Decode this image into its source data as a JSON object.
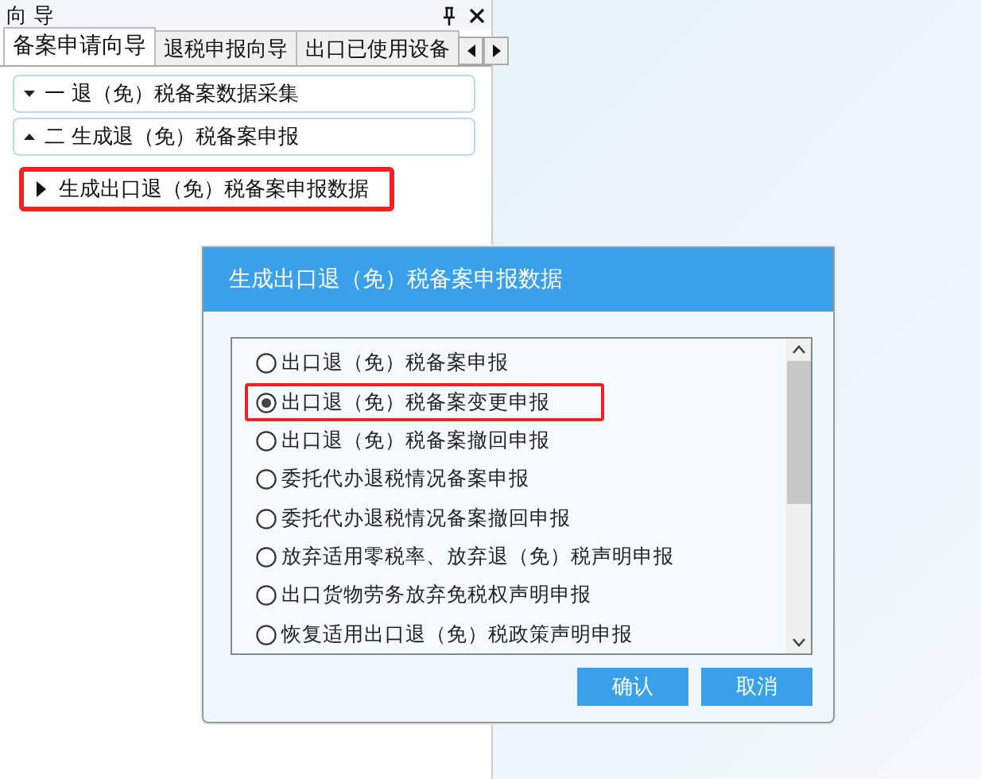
{
  "panel": {
    "title": "向 导",
    "tabs": [
      {
        "label": "备案申请向导",
        "selected": true
      },
      {
        "label": "退税申报向导",
        "selected": false
      },
      {
        "label": "出口已使用设备",
        "selected": false
      }
    ],
    "tree": [
      {
        "label": "一  退（免）税备案数据采集",
        "expanded": false
      },
      {
        "label": "二  生成退（免）税备案申报",
        "expanded": true,
        "children": [
          {
            "label": "生成出口退（免）税备案申报数据",
            "highlighted": true
          }
        ]
      }
    ]
  },
  "dialog": {
    "title": "生成出口退（免）税备案申报数据",
    "options": [
      {
        "label": "出口退（免）税备案申报",
        "selected": false,
        "highlighted": false
      },
      {
        "label": "出口退（免）税备案变更申报",
        "selected": true,
        "highlighted": true
      },
      {
        "label": "出口退（免）税备案撤回申报",
        "selected": false,
        "highlighted": false
      },
      {
        "label": "委托代办退税情况备案申报",
        "selected": false,
        "highlighted": false
      },
      {
        "label": "委托代办退税情况备案撤回申报",
        "selected": false,
        "highlighted": false
      },
      {
        "label": "放弃适用零税率、放弃退（免）税声明申报",
        "selected": false,
        "highlighted": false
      },
      {
        "label": "出口货物劳务放弃免税权声明申报",
        "selected": false,
        "highlighted": false
      },
      {
        "label": "恢复适用出口退（免）税政策声明申报",
        "selected": false,
        "highlighted": false
      }
    ],
    "buttons": [
      {
        "label": "确认"
      },
      {
        "label": "取消"
      }
    ]
  }
}
